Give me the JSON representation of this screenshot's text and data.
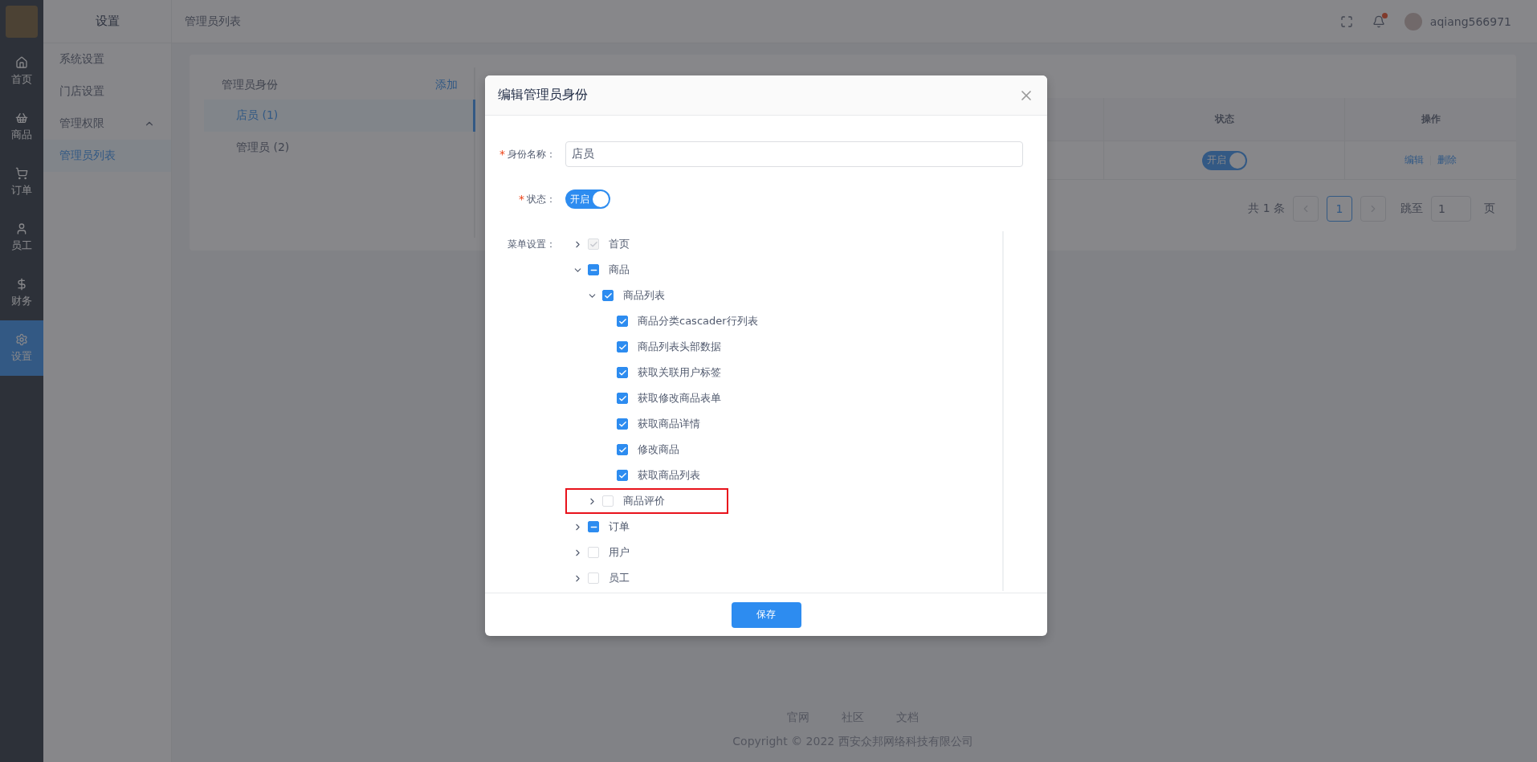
{
  "nav": [
    {
      "label": "首页",
      "selected": false
    },
    {
      "label": "商品",
      "selected": false
    },
    {
      "label": "订单",
      "selected": false
    },
    {
      "label": "员工",
      "selected": false
    },
    {
      "label": "财务",
      "selected": false
    },
    {
      "label": "设置",
      "selected": true
    }
  ],
  "submenu": {
    "title": "设置",
    "items": [
      {
        "label": "系统设置",
        "selected": false
      },
      {
        "label": "门店设置",
        "selected": false
      },
      {
        "label": "管理权限",
        "selected": false,
        "expanded": true,
        "children": [
          {
            "label": "管理员列表",
            "selected": true
          }
        ]
      }
    ]
  },
  "header": {
    "title": "管理员列表",
    "username": "aqiang566971",
    "has_notification": true
  },
  "roles": {
    "title": "管理员身份",
    "add_link": "添加",
    "items": [
      {
        "label": "店员 (1)",
        "selected": true
      },
      {
        "label": "管理员 (2)",
        "selected": false
      }
    ]
  },
  "table": {
    "columns": [
      "状态",
      "操作"
    ],
    "rows": [
      {
        "status": {
          "label": "开启",
          "on": true
        },
        "actions": [
          "编辑",
          "删除"
        ]
      }
    ]
  },
  "pagination": {
    "total": "共 1 条",
    "pages": [
      {
        "label": "1",
        "selected": true
      }
    ],
    "jump_label": "跳至",
    "jump_value": "1",
    "page_suffix": "页"
  },
  "dialog": {
    "title": "编辑管理员身份",
    "name_field": {
      "required_mark": "*",
      "label": "身份名称：",
      "value": "店员"
    },
    "status_field": {
      "required_mark": "*",
      "label": "状态：",
      "toggle": {
        "label": "开启",
        "on": true
      }
    },
    "menu_label": "菜单设置：",
    "menu_tree": [
      {
        "label": "首页",
        "checked": true,
        "indeterminate": false,
        "disabled": true,
        "expanded": false,
        "highlighted": false
      },
      {
        "label": "商品",
        "checked": false,
        "indeterminate": true,
        "disabled": false,
        "expanded": true,
        "highlighted": false,
        "children": [
          {
            "label": "商品列表",
            "checked": true,
            "indeterminate": false,
            "disabled": false,
            "expanded": true,
            "highlighted": false,
            "children": [
              {
                "label": "商品分类cascader行列表",
                "checked": true,
                "indeterminate": false,
                "disabled": false,
                "highlighted": false
              },
              {
                "label": "商品列表头部数据",
                "checked": true,
                "indeterminate": false,
                "disabled": false,
                "highlighted": false
              },
              {
                "label": "获取关联用户标签",
                "checked": true,
                "indeterminate": false,
                "disabled": false,
                "highlighted": false
              },
              {
                "label": "获取修改商品表单",
                "checked": true,
                "indeterminate": false,
                "disabled": false,
                "highlighted": false
              },
              {
                "label": "获取商品详情",
                "checked": true,
                "indeterminate": false,
                "disabled": false,
                "highlighted": false
              },
              {
                "label": "修改商品",
                "checked": true,
                "indeterminate": false,
                "disabled": false,
                "highlighted": false
              },
              {
                "label": "获取商品列表",
                "checked": true,
                "indeterminate": false,
                "disabled": false,
                "highlighted": false
              }
            ]
          },
          {
            "label": "商品评价",
            "checked": false,
            "indeterminate": false,
            "disabled": false,
            "expanded": false,
            "highlighted": true
          }
        ]
      },
      {
        "label": "订单",
        "checked": false,
        "indeterminate": true,
        "disabled": false,
        "expanded": false,
        "highlighted": false
      },
      {
        "label": "用户",
        "checked": false,
        "indeterminate": false,
        "disabled": false,
        "expanded": false,
        "highlighted": false
      },
      {
        "label": "员工",
        "checked": false,
        "indeterminate": false,
        "disabled": false,
        "expanded": false,
        "highlighted": false
      }
    ],
    "save_button": "保存"
  },
  "footer": {
    "links": [
      "官网",
      "社区",
      "文档"
    ],
    "copyright": "Copyright © 2022 西安众邦网络科技有限公司"
  }
}
